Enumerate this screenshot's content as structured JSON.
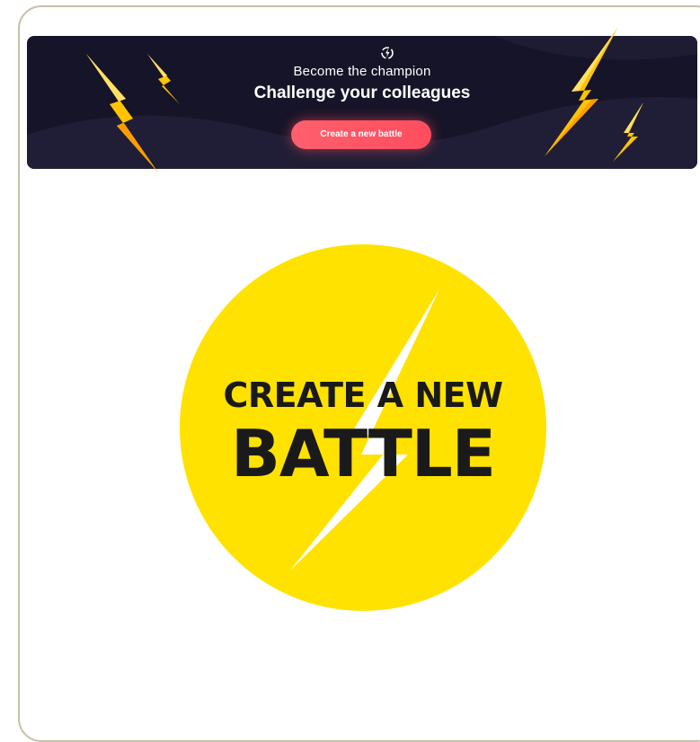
{
  "banner": {
    "subtitle": "Become the champion",
    "title": "Challenge your colleagues",
    "button_label": "Create a new battle",
    "logo_icon": "brand-logo-icon",
    "bolt_icon": "lightning-bolt-icon",
    "colors": {
      "background": "#161428",
      "button": "#ff5a69",
      "bolt": "#ffcc00"
    }
  },
  "hero": {
    "line1": "CREATE A NEW",
    "line2": "BATTLE",
    "icon": "lightning-bolt-icon",
    "colors": {
      "circle": "#ffe200",
      "bolt": "#ffffff",
      "text": "#1a1a1a"
    }
  }
}
